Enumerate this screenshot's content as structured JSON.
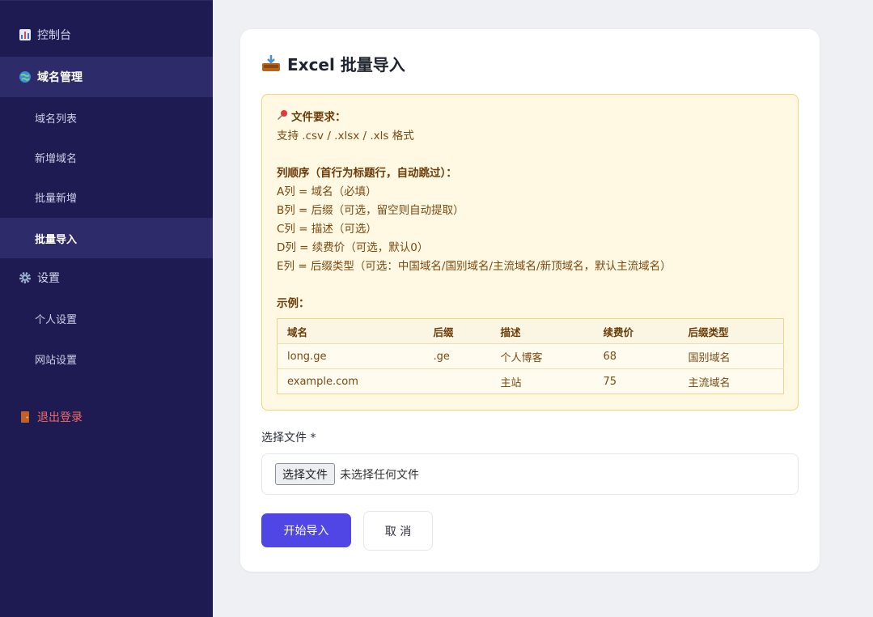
{
  "sidebar": {
    "items": [
      {
        "label": "控制台",
        "icon": "chart-icon"
      },
      {
        "label": "域名管理",
        "icon": "globe-icon"
      },
      {
        "label": "域名列表"
      },
      {
        "label": "新增域名"
      },
      {
        "label": "批量新增"
      },
      {
        "label": "批量导入"
      },
      {
        "label": "设置",
        "icon": "gear-icon"
      },
      {
        "label": "个人设置"
      },
      {
        "label": "网站设置"
      },
      {
        "label": "退出登录",
        "icon": "door-icon"
      }
    ]
  },
  "main": {
    "title": "Excel 批量导入",
    "notice": {
      "heading": "文件要求：",
      "formats": "支持 .csv / .xlsx / .xls 格式",
      "order_heading": "列顺序（首行为标题行，自动跳过）：",
      "columns": [
        "A列 = 域名（必填）",
        "B列 = 后缀（可选，留空则自动提取）",
        "C列 = 描述（可选）",
        "D列 = 续费价（可选，默认0）",
        "E列 = 后缀类型（可选：中国域名/国别域名/主流域名/新顶域名，默认主流域名）"
      ],
      "example_heading": "示例：",
      "table": {
        "headers": [
          "域名",
          "后缀",
          "描述",
          "续费价",
          "后缀类型"
        ],
        "rows": [
          [
            "long.ge",
            ".ge",
            "个人博客",
            "68",
            "国别域名"
          ],
          [
            "example.com",
            "",
            "主站",
            "75",
            "主流域名"
          ]
        ]
      }
    },
    "file_label": "选择文件 *",
    "file_button": "选择文件",
    "file_status": "未选择任何文件",
    "submit_label": "开始导入",
    "cancel_label": "取 消"
  },
  "colors": {
    "sidebar_bg": "#1e1b52",
    "sidebar_active": "#2d2b69",
    "accent": "#4f46e5",
    "notice_bg": "#fff8e3",
    "logout": "#f06a6a"
  }
}
